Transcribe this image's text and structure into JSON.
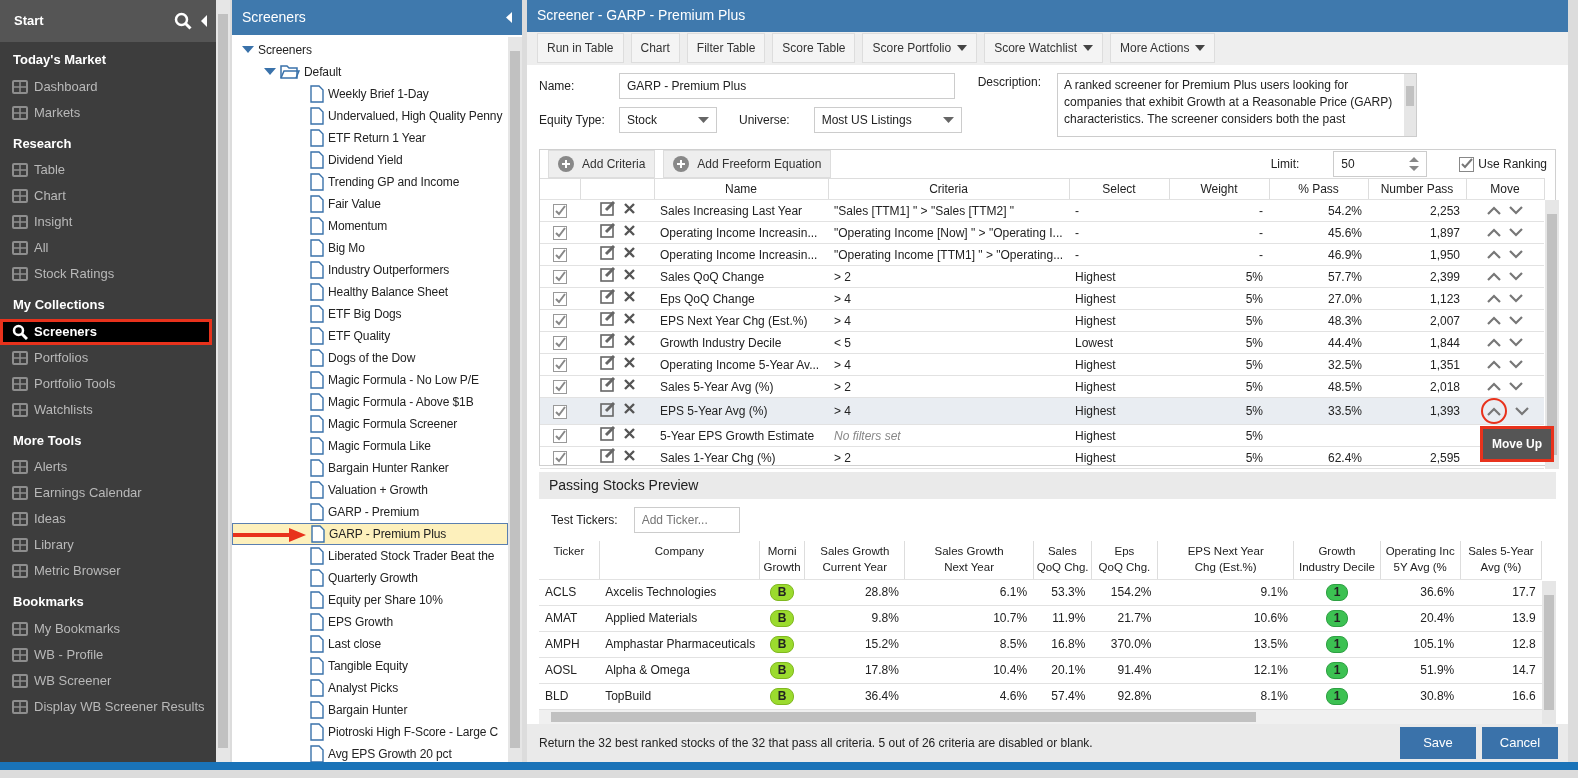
{
  "sidebar": {
    "title": "Start",
    "sections": [
      {
        "heading": "Today's Market",
        "items": [
          {
            "label": "Dashboard",
            "selected": false
          },
          {
            "label": "Markets",
            "selected": false
          }
        ]
      },
      {
        "heading": "Research",
        "items": [
          {
            "label": "Table",
            "selected": false
          },
          {
            "label": "Chart",
            "selected": false
          },
          {
            "label": "Insight",
            "selected": false
          },
          {
            "label": "All",
            "selected": false
          },
          {
            "label": "Stock Ratings",
            "selected": false
          }
        ]
      },
      {
        "heading": "My Collections",
        "items": [
          {
            "label": "Screeners",
            "selected": true
          },
          {
            "label": "Portfolios",
            "selected": false
          },
          {
            "label": "Portfolio Tools",
            "selected": false
          },
          {
            "label": "Watchlists",
            "selected": false
          }
        ]
      },
      {
        "heading": "More Tools",
        "items": [
          {
            "label": "Alerts",
            "selected": false
          },
          {
            "label": "Earnings Calendar",
            "selected": false
          },
          {
            "label": "Ideas",
            "selected": false
          },
          {
            "label": "Library",
            "selected": false
          },
          {
            "label": "Metric Browser",
            "selected": false
          }
        ]
      },
      {
        "heading": "Bookmarks",
        "items": [
          {
            "label": "My Bookmarks",
            "selected": false
          },
          {
            "label": "WB - Profile",
            "selected": false
          },
          {
            "label": "WB Screener",
            "selected": false
          },
          {
            "label": "Display WB Screener Results",
            "selected": false
          }
        ]
      }
    ]
  },
  "tree_panel": {
    "title": "Screeners",
    "tree": [
      {
        "label": "Screeners",
        "kind": "folder",
        "expanded": true,
        "children": [
          {
            "label": "Default",
            "kind": "folder",
            "expanded": true,
            "children": [
              {
                "label": "Weekly Brief 1-Day",
                "kind": "file",
                "selected": false
              },
              {
                "label": "Undervalued, High Quality Penny",
                "kind": "file",
                "selected": false
              },
              {
                "label": "ETF Return 1 Year",
                "kind": "file",
                "selected": false
              },
              {
                "label": "Dividend Yield",
                "kind": "file",
                "selected": false
              },
              {
                "label": "Trending GP and Income",
                "kind": "file",
                "selected": false
              },
              {
                "label": "Fair Value",
                "kind": "file",
                "selected": false
              },
              {
                "label": "Momentum",
                "kind": "file",
                "selected": false
              },
              {
                "label": "Big Mo",
                "kind": "file",
                "selected": false
              },
              {
                "label": "Industry Outperformers",
                "kind": "file",
                "selected": false
              },
              {
                "label": "Healthy Balance Sheet",
                "kind": "file",
                "selected": false
              },
              {
                "label": "ETF Big Dogs",
                "kind": "file",
                "selected": false
              },
              {
                "label": "ETF Quality",
                "kind": "file",
                "selected": false
              },
              {
                "label": "Dogs of the Dow",
                "kind": "file",
                "selected": false
              },
              {
                "label": "Magic Formula - No Low P/E",
                "kind": "file",
                "selected": false
              },
              {
                "label": "Magic Formula - Above $1B",
                "kind": "file",
                "selected": false
              },
              {
                "label": "Magic Formula Screener",
                "kind": "file",
                "selected": false
              },
              {
                "label": "Magic Formula Like",
                "kind": "file",
                "selected": false
              },
              {
                "label": "Bargain Hunter Ranker",
                "kind": "file",
                "selected": false
              },
              {
                "label": "Valuation + Growth",
                "kind": "file",
                "selected": false
              },
              {
                "label": "GARP - Premium",
                "kind": "file",
                "selected": false
              },
              {
                "label": "GARP - Premium Plus",
                "kind": "file",
                "selected": true
              },
              {
                "label": "Liberated Stock Trader Beat the",
                "kind": "file",
                "selected": false
              },
              {
                "label": "Quarterly Growth",
                "kind": "file",
                "selected": false
              },
              {
                "label": "Equity per Share 10%",
                "kind": "file",
                "selected": false
              },
              {
                "label": "EPS Growth",
                "kind": "file",
                "selected": false
              },
              {
                "label": "Last close",
                "kind": "file",
                "selected": false
              },
              {
                "label": "Tangible Equity",
                "kind": "file",
                "selected": false
              },
              {
                "label": "Analyst Picks",
                "kind": "file",
                "selected": false
              },
              {
                "label": "Bargain Hunter",
                "kind": "file",
                "selected": false
              },
              {
                "label": "Piotroski High F-Score - Large C",
                "kind": "file",
                "selected": false
              },
              {
                "label": "Avg EPS Growth 20 pct",
                "kind": "file",
                "selected": false
              }
            ]
          }
        ]
      }
    ]
  },
  "window": {
    "title": "Screener - GARP - Premium Plus"
  },
  "toolbar": [
    {
      "label": "Run in Table",
      "dropdown": false
    },
    {
      "label": "Chart",
      "dropdown": false
    },
    {
      "label": "Filter Table",
      "dropdown": false
    },
    {
      "label": "Score Table",
      "dropdown": false
    },
    {
      "label": "Score Portfolio",
      "dropdown": true
    },
    {
      "label": "Score Watchlist",
      "dropdown": true
    },
    {
      "label": "More Actions",
      "dropdown": true
    }
  ],
  "form": {
    "name_label": "Name:",
    "name_value": "GARP - Premium Plus",
    "equity_label": "Equity Type:",
    "equity_value": "Stock",
    "universe_label": "Universe:",
    "universe_value": "Most US Listings",
    "description_label": "Description:",
    "description": "A ranked screener for Premium Plus users looking for companies that exhibit Growth at a Reasonable Price (GARP) characteristics. The screener considers both the past"
  },
  "criteria": {
    "add_buttons": [
      "Add Criteria",
      "Add Freeform Equation"
    ],
    "limit_label": "Limit:",
    "limit_value": "50",
    "use_ranking": {
      "label": "Use Ranking",
      "checked": true
    },
    "tooltip": "Move Up",
    "columns": [
      "Name",
      "Criteria",
      "Select",
      "Weight",
      "% Pass",
      "Number Pass",
      "Move"
    ],
    "rows": [
      {
        "enabled": true,
        "selected": false,
        "filtered": true,
        "name": "Sales Increasing Last Year",
        "criteria": "\"Sales [TTM1] \" > \"Sales [TTM2] \"",
        "select": "-",
        "weight": "-",
        "pass": "54.2%",
        "number": "2,253"
      },
      {
        "enabled": true,
        "selected": false,
        "filtered": true,
        "name": "Operating Income Increasin...",
        "criteria": "\"Operating Income [Now] \" > \"Operating I...",
        "select": "-",
        "weight": "-",
        "pass": "45.6%",
        "number": "1,897"
      },
      {
        "enabled": true,
        "selected": false,
        "filtered": true,
        "name": "Operating Income Increasin...",
        "criteria": "\"Operating Income [TTM1] \" > \"Operating...",
        "select": "-",
        "weight": "-",
        "pass": "46.9%",
        "number": "1,950"
      },
      {
        "enabled": true,
        "selected": false,
        "filtered": true,
        "name": "Sales QoQ Change",
        "criteria": "> 2",
        "select": "Highest",
        "weight": "5%",
        "pass": "57.7%",
        "number": "2,399"
      },
      {
        "enabled": true,
        "selected": false,
        "filtered": true,
        "name": "Eps QoQ Change",
        "criteria": "> 4",
        "select": "Highest",
        "weight": "5%",
        "pass": "27.0%",
        "number": "1,123"
      },
      {
        "enabled": true,
        "selected": false,
        "filtered": true,
        "name": "EPS Next Year Chg (Est.%)",
        "criteria": "> 4",
        "select": "Highest",
        "weight": "5%",
        "pass": "48.3%",
        "number": "2,007"
      },
      {
        "enabled": true,
        "selected": false,
        "filtered": true,
        "name": "Growth Industry Decile",
        "criteria": "< 5",
        "select": "Lowest",
        "weight": "5%",
        "pass": "44.4%",
        "number": "1,844"
      },
      {
        "enabled": true,
        "selected": false,
        "filtered": true,
        "name": "Operating Income 5-Year Av...",
        "criteria": "> 4",
        "select": "Highest",
        "weight": "5%",
        "pass": "32.5%",
        "number": "1,351"
      },
      {
        "enabled": true,
        "selected": false,
        "filtered": true,
        "name": "Sales 5-Year Avg (%)",
        "criteria": "> 2",
        "select": "Highest",
        "weight": "5%",
        "pass": "48.5%",
        "number": "2,018"
      },
      {
        "enabled": true,
        "selected": true,
        "filtered": true,
        "name": "EPS 5-Year Avg (%)",
        "criteria": "> 4",
        "select": "Highest",
        "weight": "5%",
        "pass": "33.5%",
        "number": "1,393"
      },
      {
        "enabled": true,
        "selected": false,
        "filtered": false,
        "name": "5-Year EPS Growth Estimate",
        "criteria": "No filters set",
        "select": "Highest",
        "weight": "5%"
      },
      {
        "enabled": true,
        "selected": false,
        "filtered": true,
        "name": "Sales 1-Year Chg (%)",
        "criteria": "> 2",
        "select": "Highest",
        "weight": "5%",
        "pass": "62.4%",
        "number": "2,595"
      }
    ]
  },
  "preview": {
    "title": "Passing Stocks Preview",
    "tickers_label": "Test Tickers:",
    "tickers_placeholder": "Add Ticker...",
    "columns": [
      {
        "label": "Ticker",
        "kind": "text"
      },
      {
        "label": "Company",
        "kind": "text"
      },
      {
        "label": "Morni\nGrowth",
        "kind": "grade"
      },
      {
        "label": "Sales Growth\nCurrent Year",
        "kind": "num"
      },
      {
        "label": "Sales Growth\nNext Year",
        "kind": "num"
      },
      {
        "label": "Sales\nQoQ Chg.",
        "kind": "num"
      },
      {
        "label": "Eps\nQoQ Chg.",
        "kind": "num"
      },
      {
        "label": "EPS Next Year\nChg (Est.%)",
        "kind": "num"
      },
      {
        "label": "Growth\nIndustry Decile",
        "kind": "decile"
      },
      {
        "label": "Operating Inc\n5Y Avg (%",
        "kind": "num"
      },
      {
        "label": "Sales 5-Year\nAvg (%)",
        "kind": "num"
      }
    ],
    "rows": [
      [
        "ACLS",
        "Axcelis Technologies",
        "B",
        "28.8%",
        "6.1%",
        "53.3%",
        "154.2%",
        "9.1%",
        "1",
        "36.6%",
        "17.7"
      ],
      [
        "AMAT",
        "Applied Materials",
        "B",
        "9.8%",
        "10.7%",
        "11.9%",
        "21.7%",
        "10.6%",
        "1",
        "20.4%",
        "13.9"
      ],
      [
        "AMPH",
        "Amphastar Pharmaceuticals",
        "B",
        "15.2%",
        "8.5%",
        "16.8%",
        "370.0%",
        "13.5%",
        "1",
        "105.1%",
        "12.8"
      ],
      [
        "AOSL",
        "Alpha & Omega",
        "B",
        "17.8%",
        "10.4%",
        "20.1%",
        "91.4%",
        "12.1%",
        "1",
        "51.9%",
        "14.7"
      ],
      [
        "BLD",
        "TopBuild",
        "B",
        "36.4%",
        "4.6%",
        "57.4%",
        "92.8%",
        "8.1%",
        "1",
        "30.8%",
        "16.6"
      ]
    ]
  },
  "footer": {
    "summary": "Return the 32 best ranked stocks of the 32 that pass all criteria. 5 out of 26 criteria are disabled or blank.",
    "buttons": [
      "Save",
      "Cancel"
    ]
  }
}
